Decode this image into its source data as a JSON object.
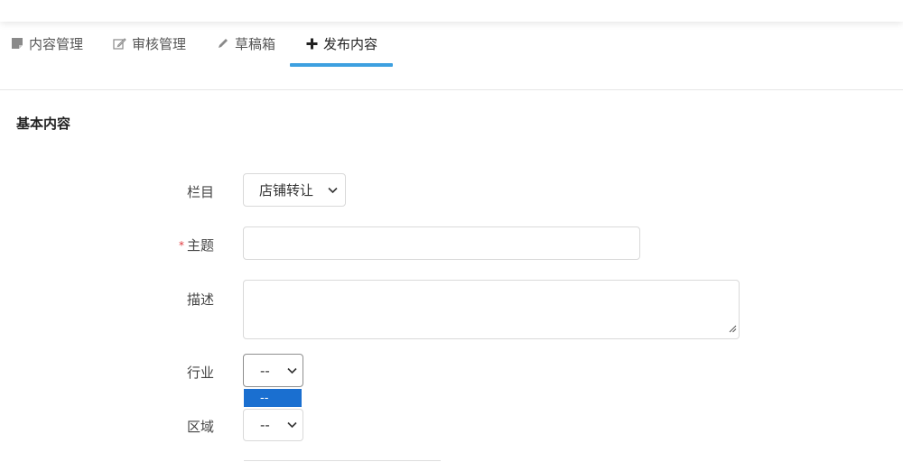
{
  "tabs": [
    {
      "label": "内容管理",
      "icon": "document-icon"
    },
    {
      "label": "审核管理",
      "icon": "edit-icon"
    },
    {
      "label": "草稿箱",
      "icon": "pencil-icon"
    },
    {
      "label": "发布内容",
      "icon": "plus-icon",
      "active": true
    }
  ],
  "section": {
    "title": "基本内容"
  },
  "form": {
    "category": {
      "label": "栏目",
      "value": "店铺转让"
    },
    "subject": {
      "label": "主题",
      "required_mark": "*",
      "value": ""
    },
    "description": {
      "label": "描述",
      "value": ""
    },
    "industry": {
      "label": "行业",
      "value": "--",
      "dropdown_option": "--"
    },
    "region": {
      "label": "区域",
      "value": "--"
    }
  },
  "colors": {
    "accent": "#3da0e0",
    "required": "#e0393e",
    "dropdown_highlight": "#1a6fd0"
  }
}
